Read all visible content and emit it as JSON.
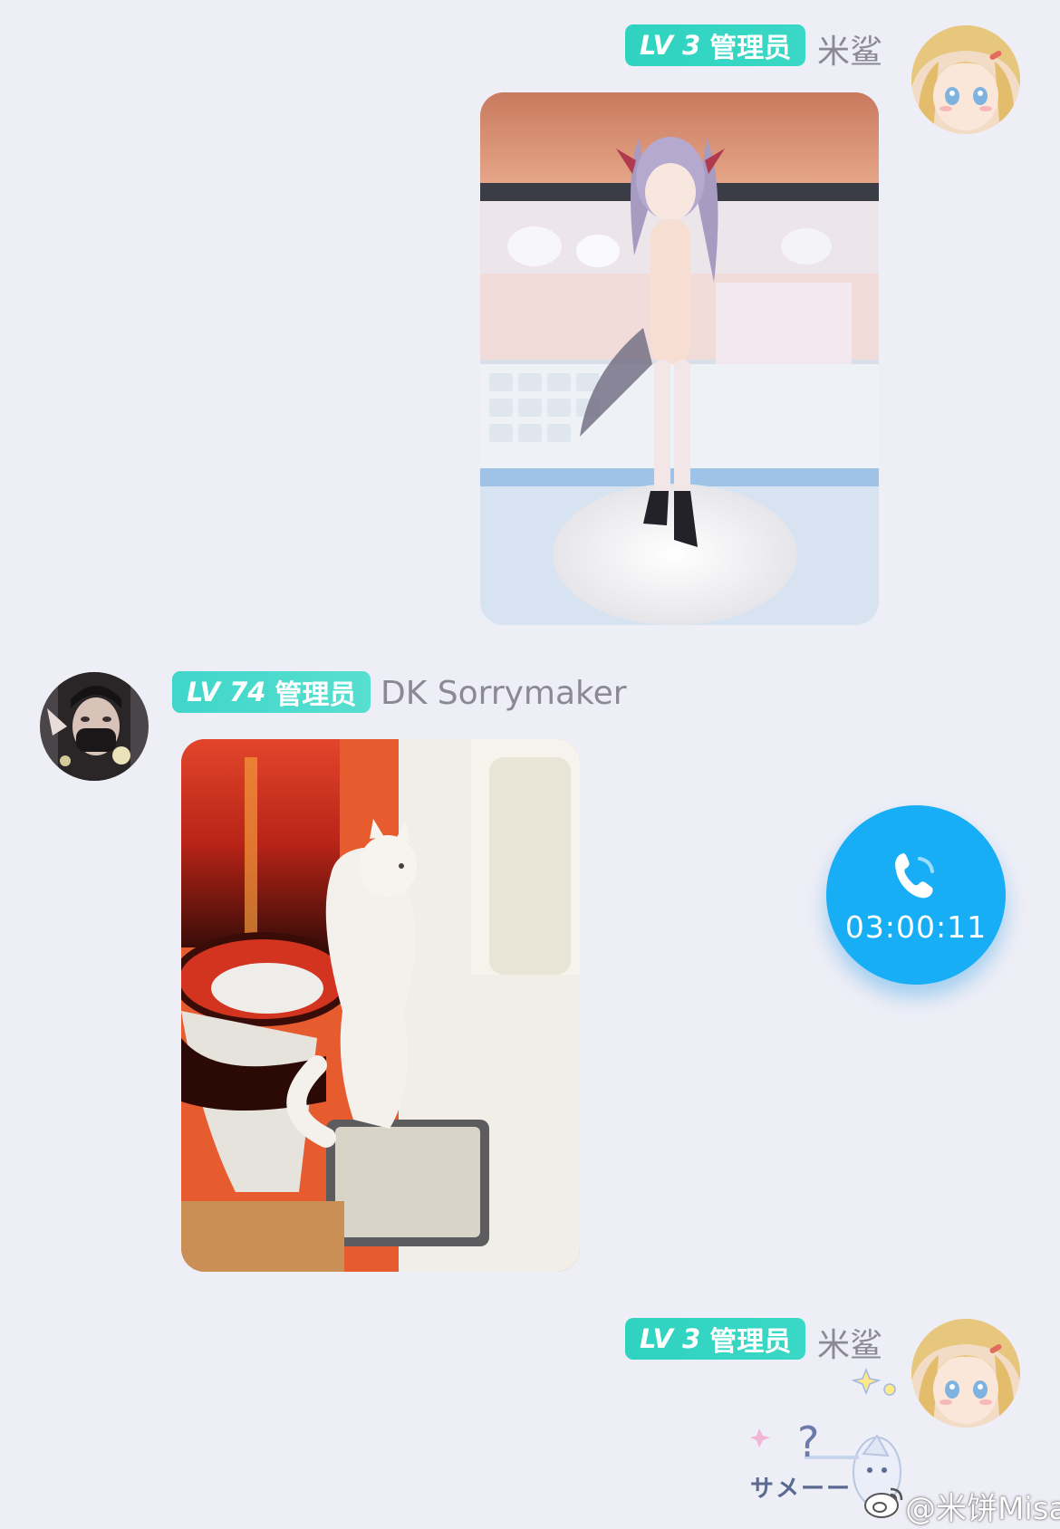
{
  "messages": [
    {
      "side": "right",
      "level": "LV 3",
      "role": "管理员",
      "sender": "米鲨",
      "avatar_icon": "anime-girl-avatar"
    },
    {
      "side": "left",
      "level": "LV 74",
      "role": "管理员",
      "sender": "DK Sorrymaker",
      "avatar_icon": "masked-person-avatar"
    },
    {
      "side": "right",
      "level": "LV 3",
      "role": "管理员",
      "sender": "米鲨",
      "avatar_icon": "anime-girl-avatar"
    }
  ],
  "call": {
    "icon": "phone-icon",
    "duration": "03:00:11",
    "color": "#17aef6"
  },
  "sticker": {
    "mark": "?",
    "text": "サメーー"
  },
  "watermark": {
    "text": "@米饼Misa",
    "icon": "weibo-icon"
  },
  "colors": {
    "background": "#eeeef6",
    "badge": "#2fd3bf",
    "name": "#8b8a94"
  }
}
